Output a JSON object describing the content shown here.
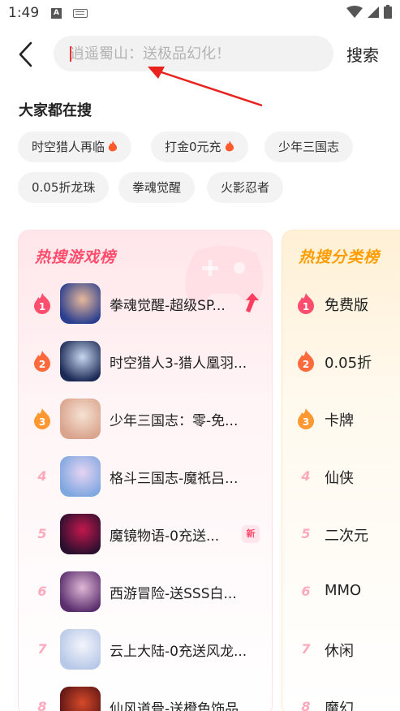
{
  "status_bar": {
    "time": "1:49",
    "keyboard_icon": "keyboard-icon",
    "a_icon": "A"
  },
  "header": {
    "back_icon": "chevron-left-icon",
    "search_placeholder": "逍遥蜀山：送极品幻化！",
    "search_value": "",
    "search_label": "搜索"
  },
  "hot_search": {
    "title": "大家都在搜",
    "tags": [
      {
        "label": "时空猎人再临",
        "hot": true
      },
      {
        "label": "打金0元充",
        "hot": true
      },
      {
        "label": "少年三国志",
        "hot": false
      },
      {
        "label": "0.05折龙珠",
        "hot": false
      },
      {
        "label": "拳魂觉醒",
        "hot": false
      },
      {
        "label": "火影忍者",
        "hot": false
      }
    ]
  },
  "game_ranking": {
    "title": "热搜游戏榜",
    "items": [
      {
        "rank": "1",
        "name": "拳魂觉醒-超级SP...",
        "badge": "trend-up",
        "icon_colors": [
          "#2a3f8f",
          "#e8b89a"
        ]
      },
      {
        "rank": "2",
        "name": "时空猎人3-猎人凰羽...",
        "badge": "",
        "icon_colors": [
          "#1b2a55",
          "#c7d6ef"
        ]
      },
      {
        "rank": "3",
        "name": "少年三国志：零-免...",
        "badge": "",
        "icon_colors": [
          "#d9a38c",
          "#f6e2d3"
        ]
      },
      {
        "rank": "4",
        "name": "格斗三国志-魔祇吕...",
        "badge": "",
        "icon_colors": [
          "#7fa7e0",
          "#e6d4f2"
        ]
      },
      {
        "rank": "5",
        "name": "魔镜物语-0充送...",
        "badge": "新",
        "icon_colors": [
          "#2b0f2e",
          "#c2184d"
        ]
      },
      {
        "rank": "6",
        "name": "西游冒险-送SSS白...",
        "badge": "",
        "icon_colors": [
          "#5a2f6e",
          "#e0b7d6"
        ]
      },
      {
        "rank": "7",
        "name": "云上大陆-0充送风龙...",
        "badge": "",
        "icon_colors": [
          "#b8c8e8",
          "#f3f5fb"
        ]
      },
      {
        "rank": "8",
        "name": "仙风道骨-送橙色饰品...",
        "badge": "",
        "icon_colors": [
          "#5a1414",
          "#d64a2a"
        ]
      }
    ]
  },
  "category_ranking": {
    "title": "热搜分类榜",
    "items": [
      {
        "rank": "1",
        "name": "免费版"
      },
      {
        "rank": "2",
        "name": "0.05折"
      },
      {
        "rank": "3",
        "name": "卡牌"
      },
      {
        "rank": "4",
        "name": "仙侠"
      },
      {
        "rank": "5",
        "name": "二次元"
      },
      {
        "rank": "6",
        "name": "MMO"
      },
      {
        "rank": "7",
        "name": "休闲"
      },
      {
        "rank": "8",
        "name": "魔幻"
      }
    ]
  },
  "colors": {
    "accent_pink": "#ff4d6d",
    "accent_orange": "#ff9d00",
    "rank_pink": "#ffa9bd"
  }
}
